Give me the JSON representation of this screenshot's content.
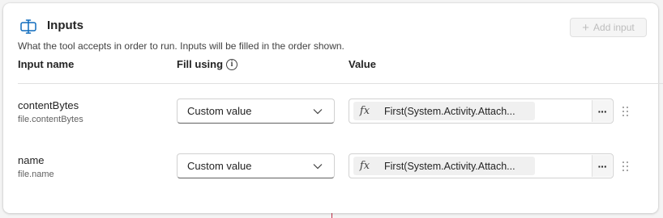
{
  "header": {
    "icon": "input-icon",
    "title": "Inputs",
    "subtitle": "What the tool accepts in order to run. Inputs will be filled in the order shown.",
    "add_button_label": "Add input"
  },
  "columns": {
    "input_name": "Input name",
    "fill_using": "Fill using",
    "value": "Value"
  },
  "inputs": [
    {
      "name": "contentBytes",
      "path": "file.contentBytes",
      "fill_using": "Custom value",
      "formula": "First(System.Activity.Attach..."
    },
    {
      "name": "name",
      "path": "file.name",
      "fill_using": "Custom value",
      "formula": "First(System.Activity.Attach..."
    }
  ],
  "colors": {
    "accent": "#0f6cbd",
    "disabled_text": "#bdbdbd",
    "border": "#d1d1d1"
  }
}
